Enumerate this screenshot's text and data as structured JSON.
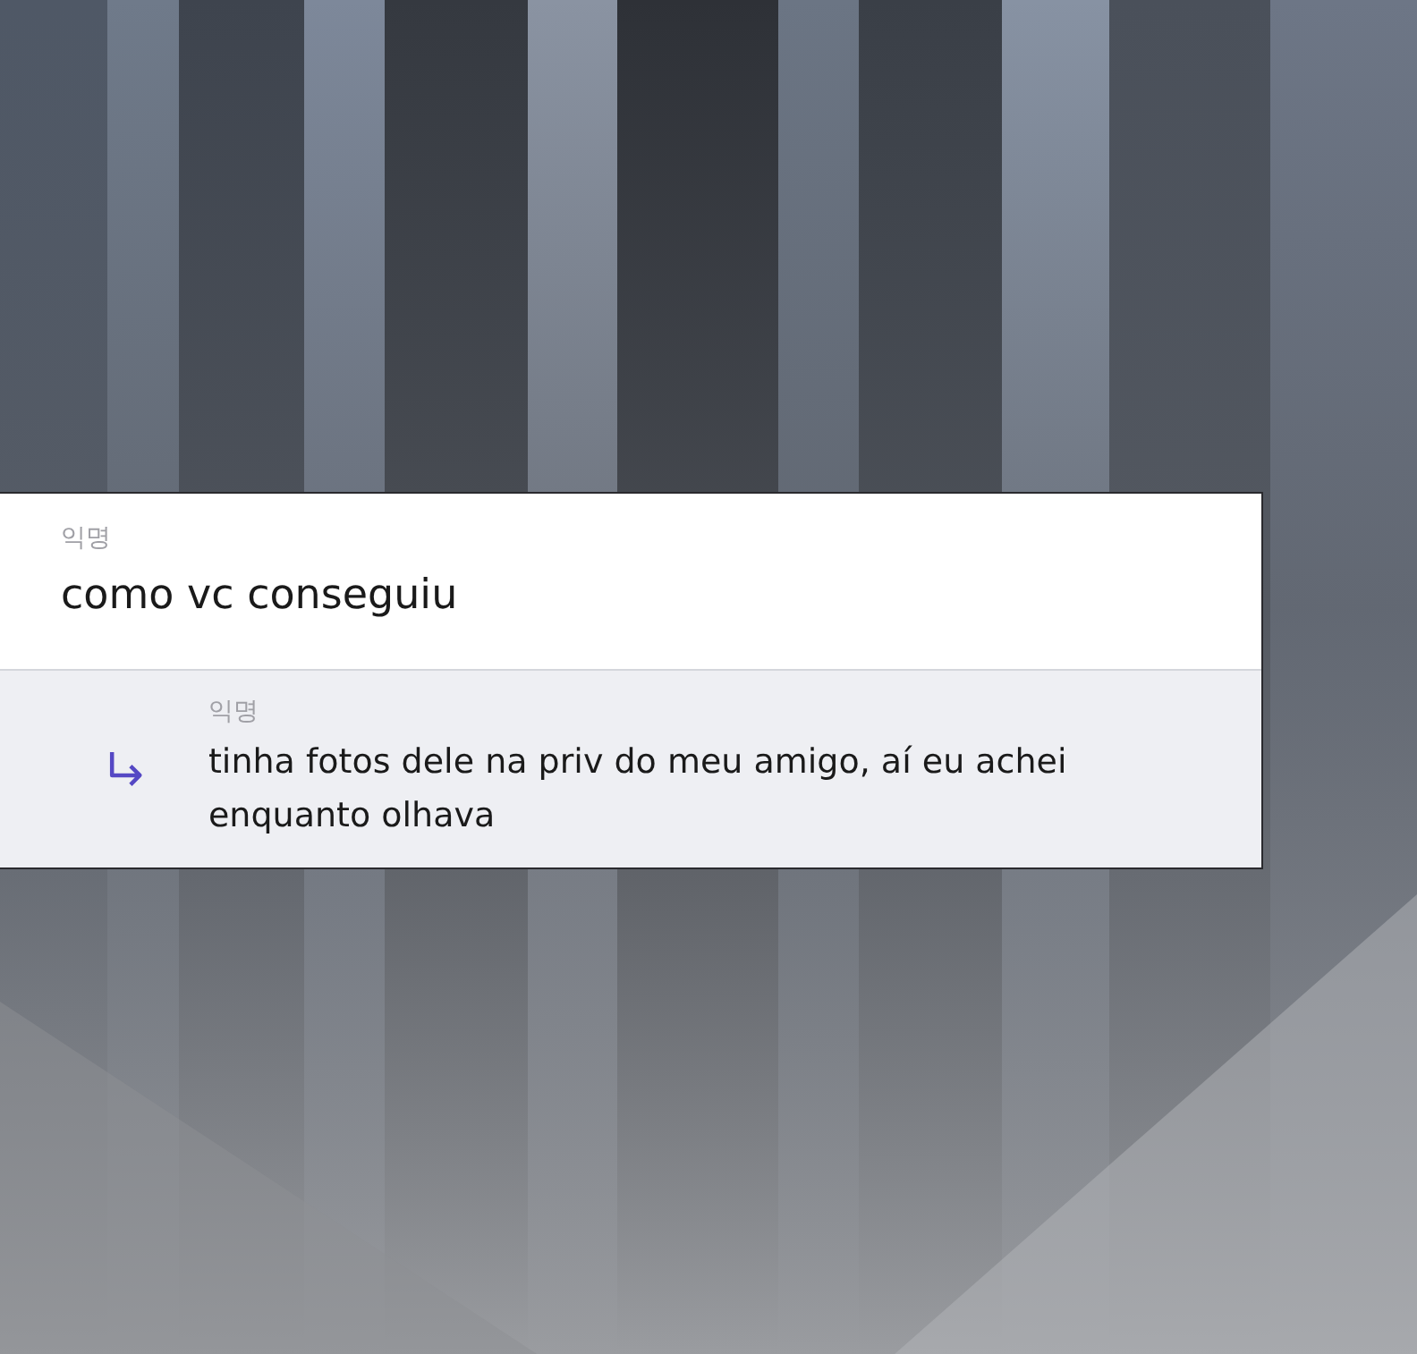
{
  "comment": {
    "author": "익명",
    "text": "como vc conseguiu"
  },
  "reply": {
    "author": "익명",
    "text": "tinha fotos dele na priv do meu amigo, aí eu achei enquanto olhava"
  }
}
